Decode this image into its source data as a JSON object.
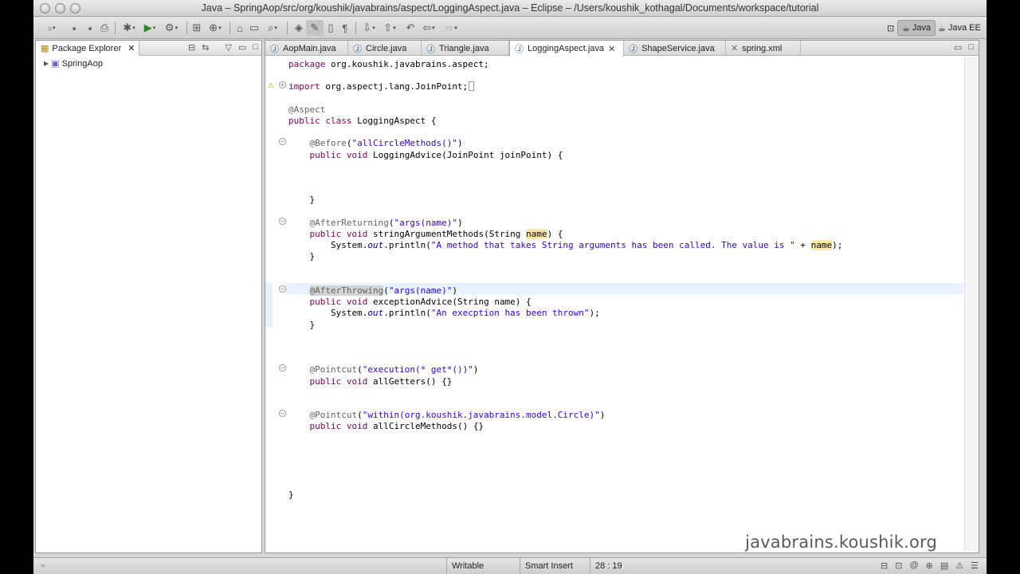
{
  "window": {
    "title": "Java – SpringAop/src/org/koushik/javabrains/aspect/LoggingAspect.java – Eclipse – /Users/koushik_kothagal/Documents/workspace/tutorial"
  },
  "toolbar": {
    "perspectives": [
      "Java",
      "Java EE"
    ]
  },
  "package_explorer": {
    "title": "Package Explorer",
    "items": [
      "SpringAop"
    ]
  },
  "editor": {
    "tabs": [
      {
        "label": "AopMain.java",
        "active": false
      },
      {
        "label": "Circle.java",
        "active": false
      },
      {
        "label": "Triangle.java",
        "active": false
      },
      {
        "label": "LoggingAspect.java",
        "active": true
      },
      {
        "label": "ShapeService.java",
        "active": false
      },
      {
        "label": "spring.xml",
        "active": false
      }
    ],
    "lines": [
      "package org.koushik.javabrains.aspect;",
      "",
      "import org.aspectj.lang.JoinPoint;",
      "",
      "@Aspect",
      "public class LoggingAspect {",
      "",
      "    @Before(\"allCircleMethods()\")",
      "    public void LoggingAdvice(JoinPoint joinPoint) {",
      "",
      "",
      "",
      "    }",
      "",
      "    @AfterReturning(\"args(name)\")",
      "    public void stringArgumentMethods(String name) {",
      "        System.out.println(\"A method that takes String arguments has been called. The value is \" + name);",
      "    }",
      "",
      "",
      "    @AfterThrowing(\"args(name)\")",
      "    public void exceptionAdvice(String name) {",
      "        System.out.println(\"An execption has been thrown\");",
      "    }",
      "",
      "",
      "",
      "    @Pointcut(\"execution(* get*())\")",
      "    public void allGetters() {}",
      "",
      "",
      "    @Pointcut(\"within(org.koushik.javabrains.model.Circle)\")",
      "    public void allCircleMethods() {}",
      "",
      "",
      "",
      "",
      "",
      "}"
    ]
  },
  "status_bar": {
    "mode": "Writable",
    "insert": "Smart Insert",
    "position": "28 : 19"
  },
  "watermark": "javabrains.koushik.org",
  "colors": {
    "keyword": "#7f0055",
    "string": "#2a00ff",
    "annotation": "#646464",
    "field": "#0000c0",
    "current_line": "#e8f2fe"
  }
}
